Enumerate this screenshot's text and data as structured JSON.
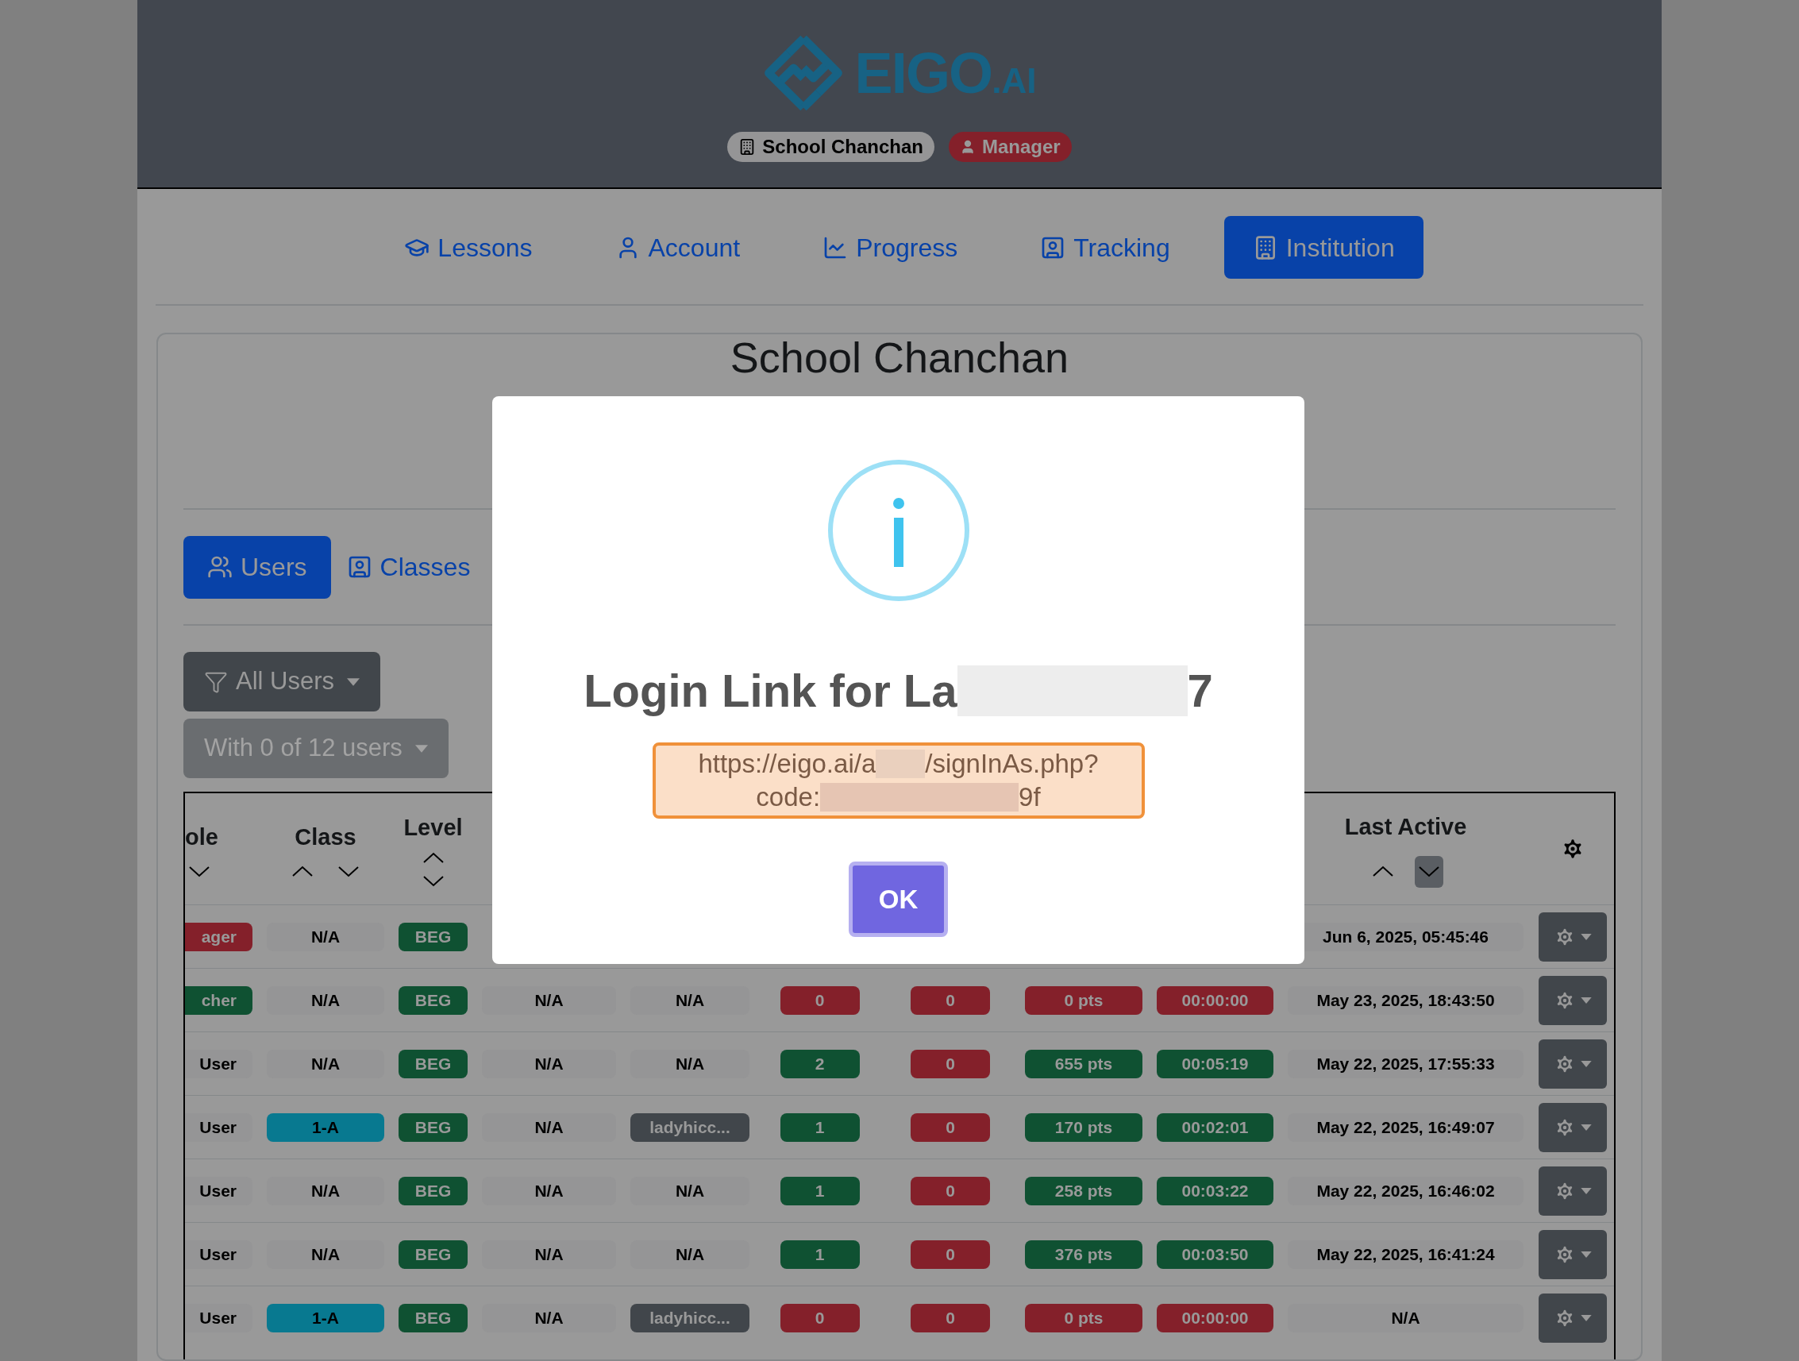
{
  "header": {
    "logo": {
      "name": "EIGO",
      "suffix": ".AI"
    },
    "badges": [
      {
        "label": "School Chanchan",
        "kind": "institution"
      },
      {
        "label": "Manager",
        "kind": "role"
      }
    ]
  },
  "nav": [
    {
      "label": "Lessons",
      "selected": false
    },
    {
      "label": "Account",
      "selected": false
    },
    {
      "label": "Progress",
      "selected": false
    },
    {
      "label": "Tracking",
      "selected": false
    },
    {
      "label": "Institution",
      "selected": true
    }
  ],
  "institution": {
    "title": "School Chanchan",
    "tabs": [
      {
        "label": "Users",
        "selected": true
      },
      {
        "label": "Classes",
        "selected": false
      }
    ],
    "filters": [
      {
        "label": "All Users",
        "disabled": false
      },
      {
        "label": "With 0 of 12 users",
        "disabled": true
      }
    ]
  },
  "table": {
    "columns": [
      {
        "label": "ole",
        "arrows": [
          {
            "kind": "down",
            "selected": false
          }
        ]
      },
      {
        "label": "Class",
        "arrows": [
          {
            "kind": "up",
            "selected": false
          },
          {
            "kind": "down",
            "selected": false
          }
        ]
      },
      {
        "label": "Level",
        "arrows": [
          {
            "kind": "up",
            "selected": false
          },
          {
            "kind": "down",
            "selected": false
          }
        ]
      },
      {
        "label": "Last Active",
        "arrows": [
          {
            "kind": "up",
            "selected": false
          },
          {
            "kind": "down",
            "selected": true
          }
        ]
      }
    ],
    "rows": [
      {
        "cells": [
          {
            "text": "ager",
            "color": "#84202a"
          },
          {
            "text": "N/A",
            "color": "#959596"
          },
          {
            "text": "BEG",
            "color": "#0f5132"
          },
          {
            "text": "Jun 6, 2025, 05:45:46",
            "color": "#959596"
          }
        ]
      },
      {
        "cells": [
          {
            "text": "cher",
            "color": "#0f5132"
          },
          {
            "text": "N/A",
            "color": "#959596"
          },
          {
            "text": "BEG",
            "color": "#0f5132"
          },
          {
            "text": "N/A",
            "color": "#959596"
          },
          {
            "text": "N/A",
            "color": "#959596"
          },
          {
            "text": "0",
            "color": "#84202a"
          },
          {
            "text": "0",
            "color": "#84202a"
          },
          {
            "text": "0 pts",
            "color": "#84202a"
          },
          {
            "text": "00:00:00",
            "color": "#84202a"
          },
          {
            "text": "May 23, 2025, 18:43:50",
            "color": "#959596"
          }
        ]
      },
      {
        "cells": [
          {
            "text": "User",
            "color": "#959596"
          },
          {
            "text": "N/A",
            "color": "#959596"
          },
          {
            "text": "BEG",
            "color": "#0f5132"
          },
          {
            "text": "N/A",
            "color": "#959596"
          },
          {
            "text": "N/A",
            "color": "#959596"
          },
          {
            "text": "2",
            "color": "#0f5132"
          },
          {
            "text": "0",
            "color": "#84202a"
          },
          {
            "text": "655 pts",
            "color": "#0f5132"
          },
          {
            "text": "00:05:19",
            "color": "#0f5132"
          },
          {
            "text": "May 22, 2025, 17:55:33",
            "color": "#959596"
          }
        ]
      },
      {
        "cells": [
          {
            "text": "User",
            "color": "#959596"
          },
          {
            "text": "1-A",
            "color": "#087990"
          },
          {
            "text": "BEG",
            "color": "#0f5132"
          },
          {
            "text": "N/A",
            "color": "#959596"
          },
          {
            "text": "ladyhicc...",
            "color": "#41464b"
          },
          {
            "text": "1",
            "color": "#0f5132"
          },
          {
            "text": "0",
            "color": "#84202a"
          },
          {
            "text": "170 pts",
            "color": "#0f5132"
          },
          {
            "text": "00:02:01",
            "color": "#0f5132"
          },
          {
            "text": "May 22, 2025, 16:49:07",
            "color": "#959596"
          }
        ]
      },
      {
        "cells": [
          {
            "text": "User",
            "color": "#959596"
          },
          {
            "text": "N/A",
            "color": "#959596"
          },
          {
            "text": "BEG",
            "color": "#0f5132"
          },
          {
            "text": "N/A",
            "color": "#959596"
          },
          {
            "text": "N/A",
            "color": "#959596"
          },
          {
            "text": "1",
            "color": "#0f5132"
          },
          {
            "text": "0",
            "color": "#84202a"
          },
          {
            "text": "258 pts",
            "color": "#0f5132"
          },
          {
            "text": "00:03:22",
            "color": "#0f5132"
          },
          {
            "text": "May 22, 2025, 16:46:02",
            "color": "#959596"
          }
        ]
      },
      {
        "cells": [
          {
            "text": "User",
            "color": "#959596"
          },
          {
            "text": "N/A",
            "color": "#959596"
          },
          {
            "text": "BEG",
            "color": "#0f5132"
          },
          {
            "text": "N/A",
            "color": "#959596"
          },
          {
            "text": "N/A",
            "color": "#959596"
          },
          {
            "text": "1",
            "color": "#0f5132"
          },
          {
            "text": "0",
            "color": "#84202a"
          },
          {
            "text": "376 pts",
            "color": "#0f5132"
          },
          {
            "text": "00:03:50",
            "color": "#0f5132"
          },
          {
            "text": "May 22, 2025, 16:41:24",
            "color": "#959596"
          }
        ]
      },
      {
        "cells": [
          {
            "text": "User",
            "color": "#959596"
          },
          {
            "text": "1-A",
            "color": "#087990"
          },
          {
            "text": "BEG",
            "color": "#0f5132"
          },
          {
            "text": "N/A",
            "color": "#959596"
          },
          {
            "text": "ladyhicc...",
            "color": "#41464b"
          },
          {
            "text": "0",
            "color": "#84202a"
          },
          {
            "text": "0",
            "color": "#84202a"
          },
          {
            "text": "0 pts",
            "color": "#84202a"
          },
          {
            "text": "00:00:00",
            "color": "#84202a"
          },
          {
            "text": "N/A",
            "color": "#959596"
          }
        ]
      }
    ]
  },
  "modal": {
    "title_start": "Login Link for La",
    "title_end": "7",
    "link": {
      "line1_start": "https://eigo.ai/a",
      "line1_end": "/signInAs.php?",
      "line2_start": "code:",
      "line2_end": "9f"
    },
    "button": "OK"
  }
}
